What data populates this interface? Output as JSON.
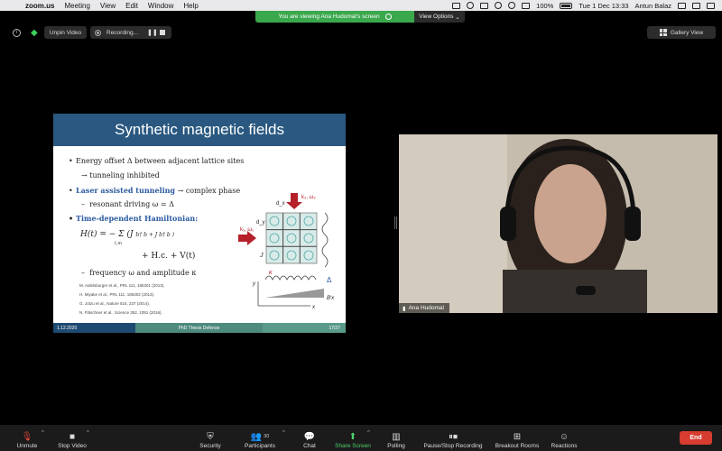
{
  "menubar": {
    "app": "zoom.us",
    "items": [
      "Meeting",
      "View",
      "Edit",
      "Window",
      "Help"
    ],
    "battery": "100%",
    "clock": "Tue 1 Dec  13:33",
    "user": "Antun Balaz"
  },
  "share_banner": {
    "text": "You are viewing Ana Hudomal's screen",
    "view_options": "View Options"
  },
  "topbar": {
    "unpin": "Unpin Video",
    "recording": "Recording...",
    "gallery_view": "Gallery View"
  },
  "slide": {
    "title": "Synthetic magnetic fields",
    "bullets": {
      "b1": "Energy offset Δ between adjacent lattice sites",
      "b1_sub": "→ tunneling inhibited",
      "b2_label": "Laser assisted tunneling",
      "b2_rest": " → complex phase",
      "b2_sub": "resonant driving  ω = Δ",
      "b3_label": "Time-dependent Hamiltonian:",
      "eq1": "H(t) = − Σ (J",
      "eq1_rest": "b† b + J b† b )",
      "eq_sum": "l,m",
      "eq2": "+ H.c. + V(t)",
      "b3_sub": "frequency ω and amplitude κ"
    },
    "references": [
      "M. Aidelsburger et al., PRL 111, 185301 (2013).",
      "H. Miyake et al., PRL 111, 185302 (2013).",
      "G. Jotzu et al., Nature 515, 237 (2014).",
      "N. Fläschner et al., Science 352, 1091 (2016)."
    ],
    "figure": {
      "k2": "k₂, ω₂",
      "k1": "k₁, ω₁",
      "dx": "d_x",
      "dy": "d_y",
      "J": "J",
      "kappa": "κ",
      "delta": "Δ",
      "bprime": "B′x",
      "y": "y",
      "x": "x"
    },
    "footer": {
      "date": "1.12.2020",
      "center": "PhD Thesis Defense",
      "page": "17/27"
    }
  },
  "video": {
    "name": "Ana Hudomal"
  },
  "toolbar": {
    "unmute": "Unmute",
    "stop_video": "Stop Video",
    "security": "Security",
    "participants": "Participants",
    "participants_count": "30",
    "chat": "Chat",
    "share_screen": "Share Screen",
    "polling": "Polling",
    "pause_stop_recording": "Pause/Stop Recording",
    "breakout_rooms": "Breakout Rooms",
    "reactions": "Reactions",
    "end": "End"
  },
  "colors": {
    "share_green": "#3aa84d",
    "slide_title_blue": "#2a5880",
    "end_red": "#d63c2f",
    "arrow_red": "#b5202a"
  }
}
